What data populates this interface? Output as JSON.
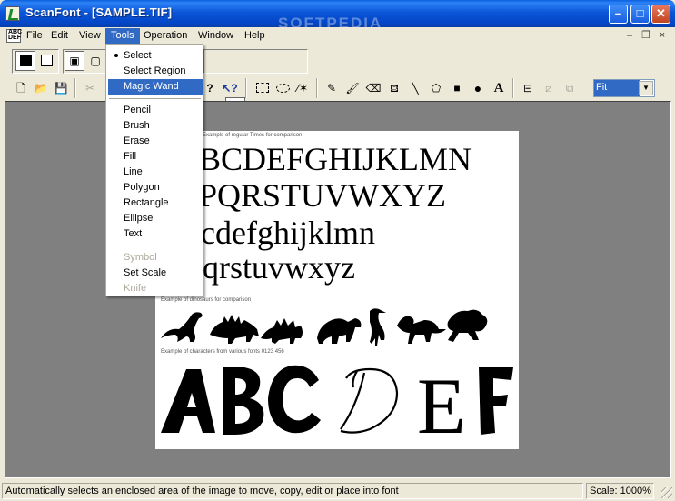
{
  "window": {
    "title": "ScanFont - [SAMPLE.TIF]",
    "watermark": "SOFTPEDIA",
    "buttons": {
      "minimize": "–",
      "maximize": "□",
      "close": "✕"
    }
  },
  "menubar": {
    "items": [
      "File",
      "Edit",
      "View",
      "Tools",
      "Operation",
      "Window",
      "Help"
    ],
    "active": "Tools",
    "mdi": {
      "minimize": "–",
      "restore": "❐",
      "close": "×"
    }
  },
  "tools_menu": {
    "items": [
      {
        "label": "Select",
        "checked": true,
        "enabled": true
      },
      {
        "label": "Select Region",
        "enabled": true
      },
      {
        "label": "Magic Wand",
        "enabled": true,
        "highlighted": true
      },
      {
        "separator": true
      },
      {
        "label": "Pencil",
        "enabled": true
      },
      {
        "label": "Brush",
        "enabled": true
      },
      {
        "label": "Erase",
        "enabled": true
      },
      {
        "label": "Fill",
        "enabled": true
      },
      {
        "label": "Line",
        "enabled": true
      },
      {
        "label": "Polygon",
        "enabled": true
      },
      {
        "label": "Rectangle",
        "enabled": true
      },
      {
        "label": "Ellipse",
        "enabled": true
      },
      {
        "label": "Text",
        "enabled": true
      },
      {
        "separator": true
      },
      {
        "label": "Symbol",
        "enabled": false
      },
      {
        "label": "Set Scale",
        "enabled": true
      },
      {
        "label": "Knife",
        "enabled": false
      }
    ]
  },
  "toolbar": {
    "zoom_value": "Fit",
    "icons": [
      "new-file-icon",
      "open-folder-icon",
      "save-icon",
      "cut-icon",
      "help-icon",
      "context-help-icon",
      "select-rect-icon",
      "select-lasso-icon",
      "magic-wand-icon",
      "pencil-icon",
      "brush-icon",
      "eraser-icon",
      "fill-bucket-icon",
      "line-icon",
      "polygon-icon",
      "rectangle-icon",
      "ellipse-icon",
      "text-icon",
      "tool-a-icon",
      "tool-b-icon",
      "tool-c-icon"
    ]
  },
  "document": {
    "caption_regular": "Example of regular Times for comparison",
    "alpha_lines": [
      "BCDEFGHIJKLMN",
      "PQRSTUVWXYZ",
      "cdefghijklmn",
      "qrstuvwxyz"
    ],
    "caption_dingbats": "Example of dinosaurs for comparison",
    "caption_deco": "Example of characters from various fonts 0123 456",
    "deco_letters": [
      "A",
      "B",
      "C",
      "D",
      "E",
      "F"
    ]
  },
  "status": {
    "message": "Automatically selects an enclosed area of the image to move, copy, edit or place into font",
    "scale": "Scale: 1000%"
  },
  "colors": {
    "titlebar": "#0a56d8",
    "highlight": "#316ac5",
    "workspace": "#808080",
    "chrome": "#ece9d8"
  }
}
